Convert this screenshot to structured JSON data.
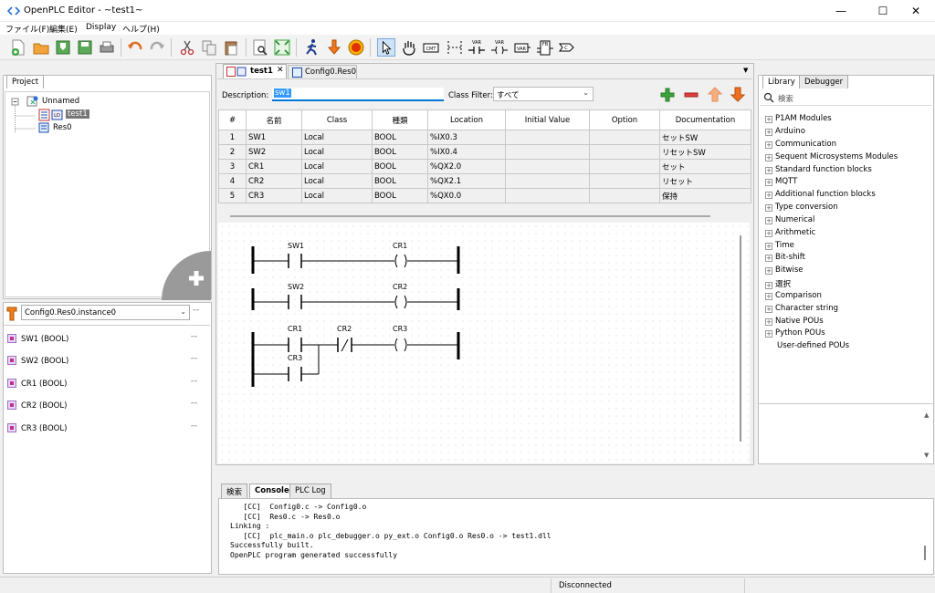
{
  "window": {
    "title": "OpenPLC Editor - ~test1~",
    "minimize": "—",
    "maximize": "☐",
    "close": "✕"
  },
  "menu": [
    "ファイル(F)",
    "編集(E)",
    "Display",
    "ヘルプ(H)"
  ],
  "project": {
    "tab": "Project",
    "root": "Unnamed",
    "pou": "test1",
    "resource": "Res0"
  },
  "instance": {
    "path": "Config0.Res0.instance0",
    "vars": [
      "SW1 (BOOL)",
      "SW2 (BOOL)",
      "CR1 (BOOL)",
      "CR2 (BOOL)",
      "CR3 (BOOL)"
    ]
  },
  "editor_tabs": [
    {
      "label": "test1"
    },
    {
      "label": "Config0.Res0"
    }
  ],
  "filter": {
    "description_label": "Description:",
    "description_value": "sw1",
    "class_filter_label": "Class Filter:",
    "class_filter_value": "すべて"
  },
  "table": {
    "headers": [
      "#",
      "名前",
      "Class",
      "種類",
      "Location",
      "Initial Value",
      "Option",
      "Documentation"
    ],
    "rows": [
      [
        "1",
        "SW1",
        "Local",
        "BOOL",
        "%IX0.3",
        "",
        "",
        "セットSW"
      ],
      [
        "2",
        "SW2",
        "Local",
        "BOOL",
        "%IX0.4",
        "",
        "",
        "リセットSW"
      ],
      [
        "3",
        "CR1",
        "Local",
        "BOOL",
        "%QX2.0",
        "",
        "",
        "セット"
      ],
      [
        "4",
        "CR2",
        "Local",
        "BOOL",
        "%QX2.1",
        "",
        "",
        "リセット"
      ],
      [
        "5",
        "CR3",
        "Local",
        "BOOL",
        "%QX0.0",
        "",
        "",
        "保持"
      ]
    ]
  },
  "ladder": {
    "labels": [
      "SW1",
      "CR1",
      "SW2",
      "CR2",
      "CR1",
      "CR2",
      "CR3",
      "CR3"
    ],
    "coil_symbol": "( )",
    "nc_symbol": "/"
  },
  "library": {
    "tabs": [
      "Library",
      "Debugger"
    ],
    "search_placeholder": "検索",
    "items": [
      "P1AM Modules",
      "Arduino",
      "Communication",
      "Sequent Microsystems Modules",
      "Standard function blocks",
      "MQTT",
      "Additional function blocks",
      "Type conversion",
      "Numerical",
      "Arithmetic",
      "Time",
      "Bit-shift",
      "Bitwise",
      "選択",
      "Comparison",
      "Character string",
      "Native POUs",
      "Python POUs",
      "User-defined POUs"
    ]
  },
  "bottom_tabs": [
    "検索",
    "Console",
    "PLC Log"
  ],
  "console_lines": [
    "   [CC]  Config0.c -> Config0.o",
    "   [CC]  Res0.c -> Res0.o",
    "Linking :",
    "   [CC]  plc_main.o plc_debugger.o py_ext.o Config0.o Res0.o -> test1.dll",
    "Successfully built.",
    "OpenPLC program generated successfully"
  ],
  "status": "Disconnected",
  "colors": {
    "accent": "#0078d7",
    "selection": "#3399ff",
    "add": "#3aa53a",
    "remove": "#e04040",
    "up": "#f0a060",
    "down": "#f07020"
  }
}
